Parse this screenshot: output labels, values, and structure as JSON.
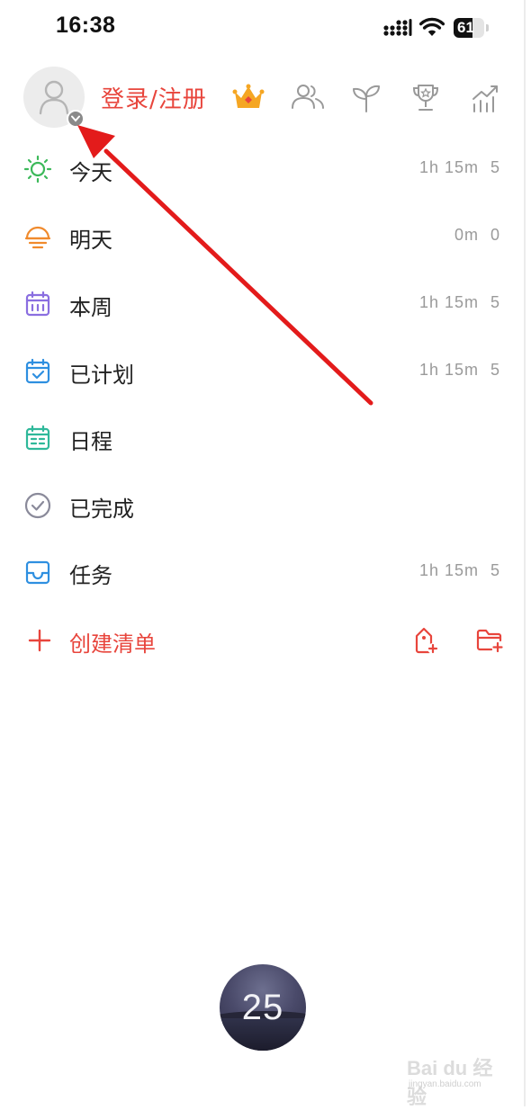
{
  "status_bar": {
    "time": "16:38",
    "battery": "61",
    "battery_level": 0.61
  },
  "header": {
    "login_label": "登录/注册",
    "icons": [
      "crown-icon",
      "people-icon",
      "sprout-icon",
      "trophy-icon",
      "stats-icon"
    ]
  },
  "menu": {
    "items": [
      {
        "label": "今天",
        "time": "1h 15m",
        "count": "5",
        "icon": "sun-icon",
        "color": "#3cb95a"
      },
      {
        "label": "明天",
        "time": "0m",
        "count": "0",
        "icon": "sunset-icon",
        "color": "#f08a2c"
      },
      {
        "label": "本周",
        "time": "1h 15m",
        "count": "5",
        "icon": "week-calendar-icon",
        "color": "#8a6ee0"
      },
      {
        "label": "已计划",
        "time": "1h 15m",
        "count": "5",
        "icon": "planned-calendar-icon",
        "color": "#2e8fe0"
      },
      {
        "label": "日程",
        "time": "",
        "count": "",
        "icon": "schedule-calendar-icon",
        "color": "#2fb89a"
      },
      {
        "label": "已完成",
        "time": "",
        "count": "",
        "icon": "check-circle-icon",
        "color": "#8a8a9a"
      },
      {
        "label": "任务",
        "time": "1h 15m",
        "count": "5",
        "icon": "inbox-icon",
        "color": "#2e8fe0"
      }
    ],
    "create_label": "创建清单"
  },
  "timer": {
    "value": "25"
  },
  "watermark": {
    "main": "Bai du 经验",
    "sub": "jingyan.baidu.com"
  },
  "colors": {
    "accent": "#e8453c",
    "annotation": "#e31b1b"
  }
}
